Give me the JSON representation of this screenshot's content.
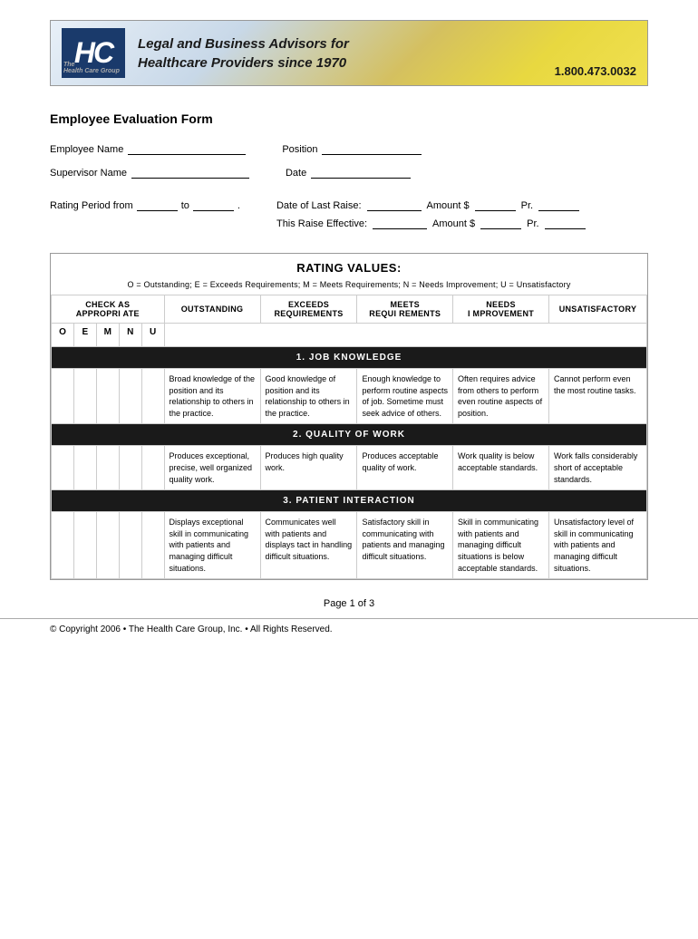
{
  "header": {
    "logo_text": "HC",
    "logo_subtext": "The\nHealth Care Group",
    "title_line1": "Legal and Business Advisors for",
    "title_line2": "Healthcare Providers since 1970",
    "phone": "1.800.473.0032"
  },
  "form": {
    "title": "Employee Evaluation Form",
    "employee_name_label": "Employee Name",
    "position_label": "Position",
    "supervisor_name_label": "Supervisor Name",
    "date_label": "Date",
    "rating_period_label": "Rating Period from",
    "rating_period_to": "to",
    "date_last_raise_label": "Date of Last Raise:",
    "amount_label": "Amount $",
    "pr_label": "Pr.",
    "this_raise_label": "This Raise Effective:",
    "amount2_label": "Amount $",
    "pr2_label": "Pr."
  },
  "rating_values": {
    "title": "RATING VALUES:",
    "legend": "O = Outstanding; E = Exceeds Requirements; M = Meets Requirements; N = Needs Improvement; U = Unsatisfactory",
    "columns": {
      "check_as": "CHECK AS\nAPPROPRI ATE",
      "outstanding": "OUTSTANDING",
      "exceeds": "EXCEEDS\nREQUIREMENTS",
      "meets": "MEETS\nREQUI REMENTS",
      "needs": "NEEDS\nI MPROVEMENT",
      "unsatisfactory": "UNSATISFACTORY"
    },
    "grade_letters": [
      "O",
      "E",
      "M",
      "N",
      "U"
    ],
    "sections": [
      {
        "number": "1",
        "title": "JOB KNOWLEDGE",
        "descriptions": [
          "Broad knowledge of the position and its relationship to others in the practice.",
          "Good knowledge of position and its relationship to others in the practice.",
          "Enough knowledge to perform routine aspects of job. Sometime must seek advice of others.",
          "Often requires advice from others to perform even routine aspects of position.",
          "Cannot perform even the most routine tasks."
        ]
      },
      {
        "number": "2",
        "title": "QUALITY OF WORK",
        "descriptions": [
          "Produces exceptional, precise, well organized quality work.",
          "Produces high quality work.",
          "Produces acceptable quality of work.",
          "Work quality is below acceptable standards.",
          "Work falls considerably short of acceptable standards."
        ]
      },
      {
        "number": "3",
        "title": "PATIENT INTERACTION",
        "descriptions": [
          "Displays exceptional skill in communicating with patients and managing difficult situations.",
          "Communicates well with patients and displays tact in handling difficult situations.",
          "Satisfactory skill in communicating with patients and managing difficult situations.",
          "Skill in communicating with patients and managing difficult situations is below acceptable standards.",
          "Unsatisfactory level of skill in communicating with patients and managing difficult situations."
        ]
      }
    ]
  },
  "footer": {
    "page_info": "Page 1 of 3",
    "copyright": "© Copyright 2006 • The Health Care Group, Inc. • All Rights Reserved."
  }
}
